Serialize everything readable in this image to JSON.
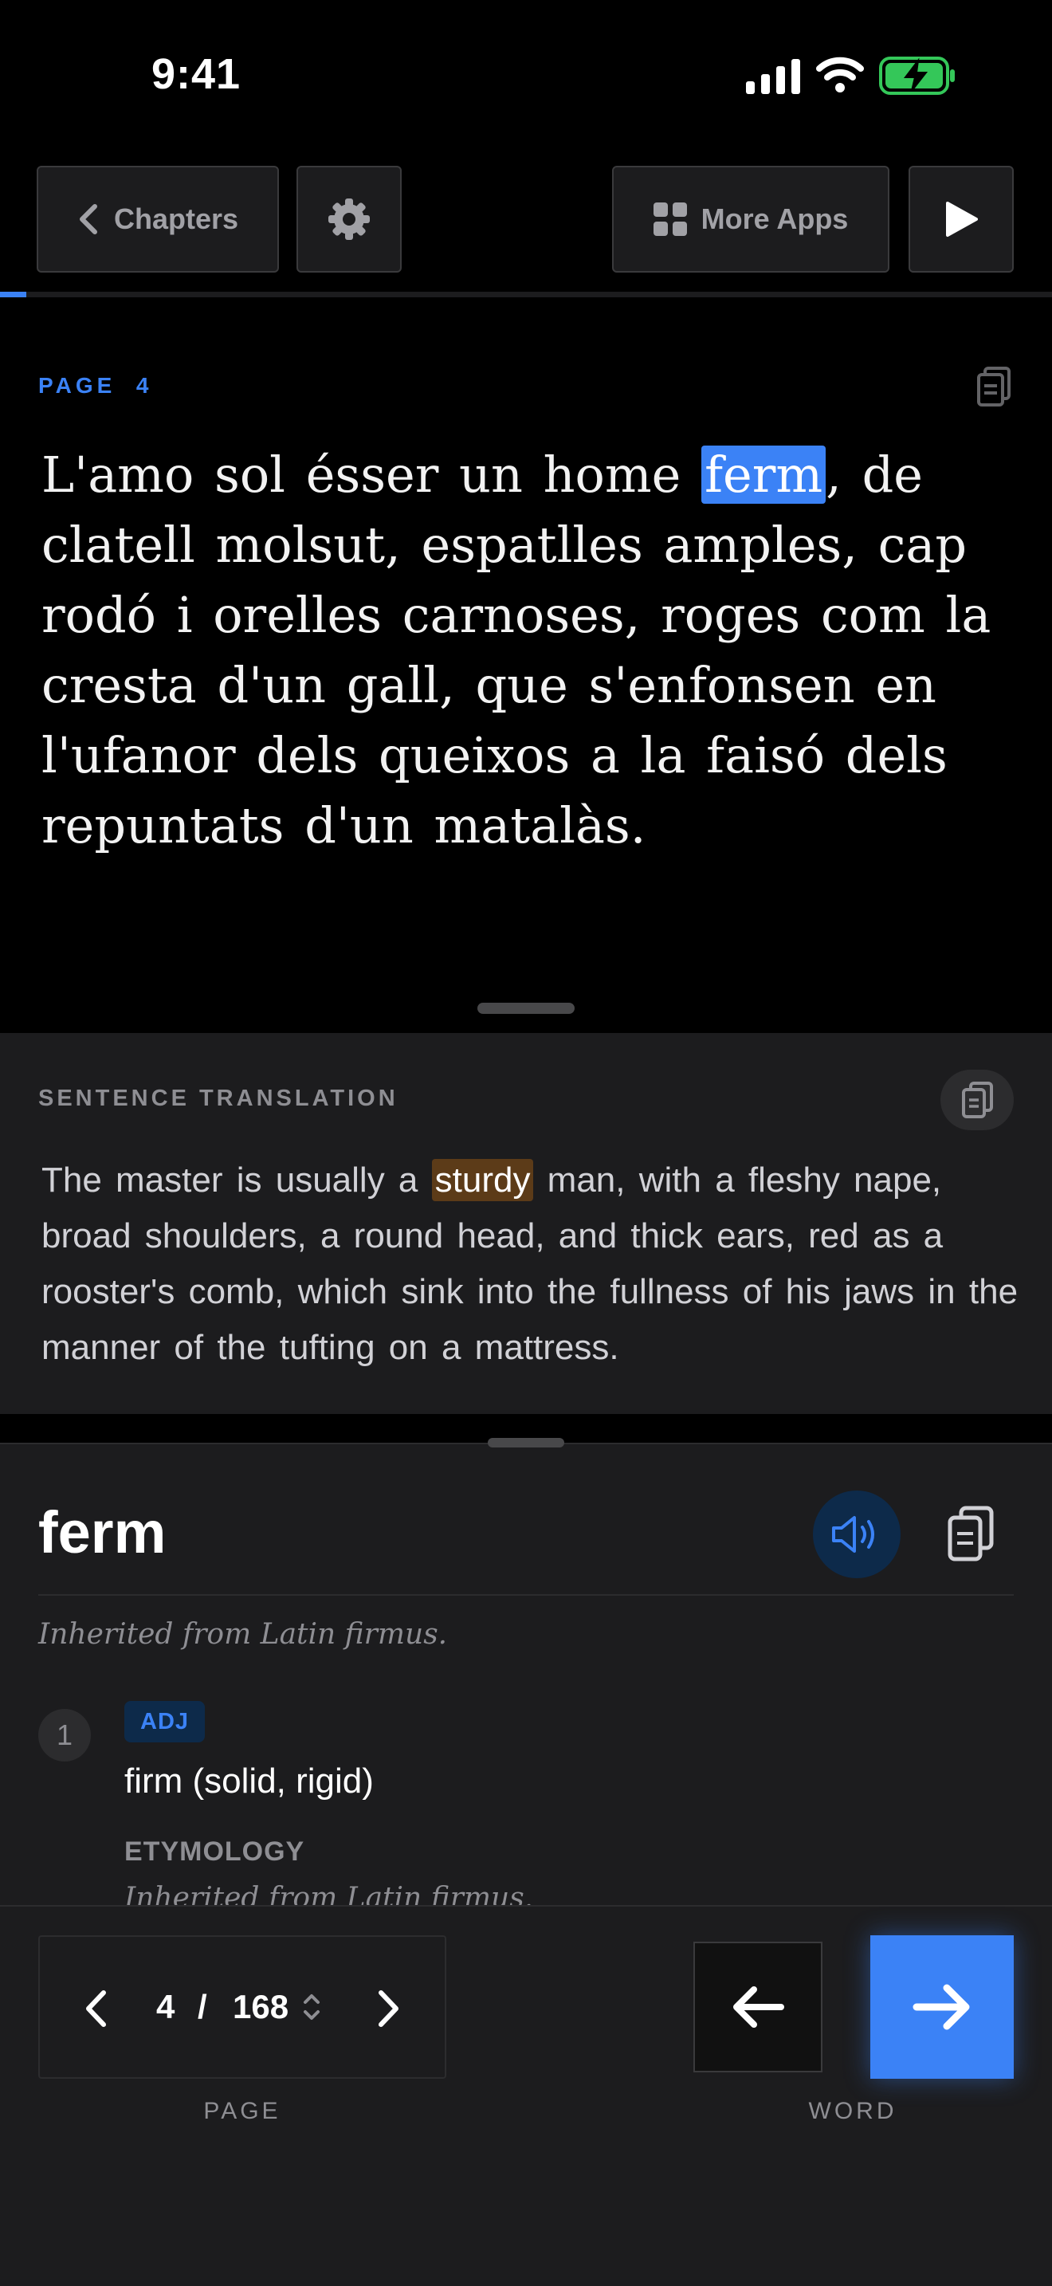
{
  "status_bar": {
    "time": "9:41",
    "icons": [
      "cellular-signal-icon",
      "wifi-icon",
      "battery-charging-icon"
    ]
  },
  "toolbar": {
    "chapters_label": "Chapters",
    "more_apps_label": "More Apps",
    "icons": [
      "chevron-left-icon",
      "gear-icon",
      "grid-icon",
      "play-icon"
    ]
  },
  "reading_progress": 0.025,
  "reader": {
    "page_label": "PAGE  4",
    "passage_before": "L'amo sol ésser un home ",
    "highlighted_word": "ferm",
    "passage_after": ", de clatell molsut, espatlles amples, cap rodó i orelles carnoses, roges com la cresta d'un gall, que s'enfonsen en l'ufanor dels queixos a la faisó dels repuntats d'un matalàs."
  },
  "translation": {
    "title": "SENTENCE TRANSLATION",
    "text_before": "The master is usually a ",
    "highlighted_word": "sturdy",
    "text_after": " man, with a fleshy nape, broad shoulders, a round head, and thick ears, red as a rooster's comb, which sink into the fullness of his jaws in the manner of the tufting on a mattress."
  },
  "dictionary": {
    "word": "ferm",
    "origin": "Inherited from Latin firmus.",
    "senses": [
      {
        "number": "1",
        "pos": "ADJ",
        "definition": "firm (solid, rigid)",
        "etymology_label": "ETYMOLOGY",
        "etymology": "Inherited from Latin firmus."
      }
    ]
  },
  "pager": {
    "current": "4",
    "separator": "/",
    "total": "168",
    "caption": "PAGE"
  },
  "word_nav": {
    "caption": "WORD"
  },
  "colors": {
    "accent": "#3b82f6",
    "panel": "#1c1c1e",
    "highlight_translation": "#5c3b18"
  }
}
